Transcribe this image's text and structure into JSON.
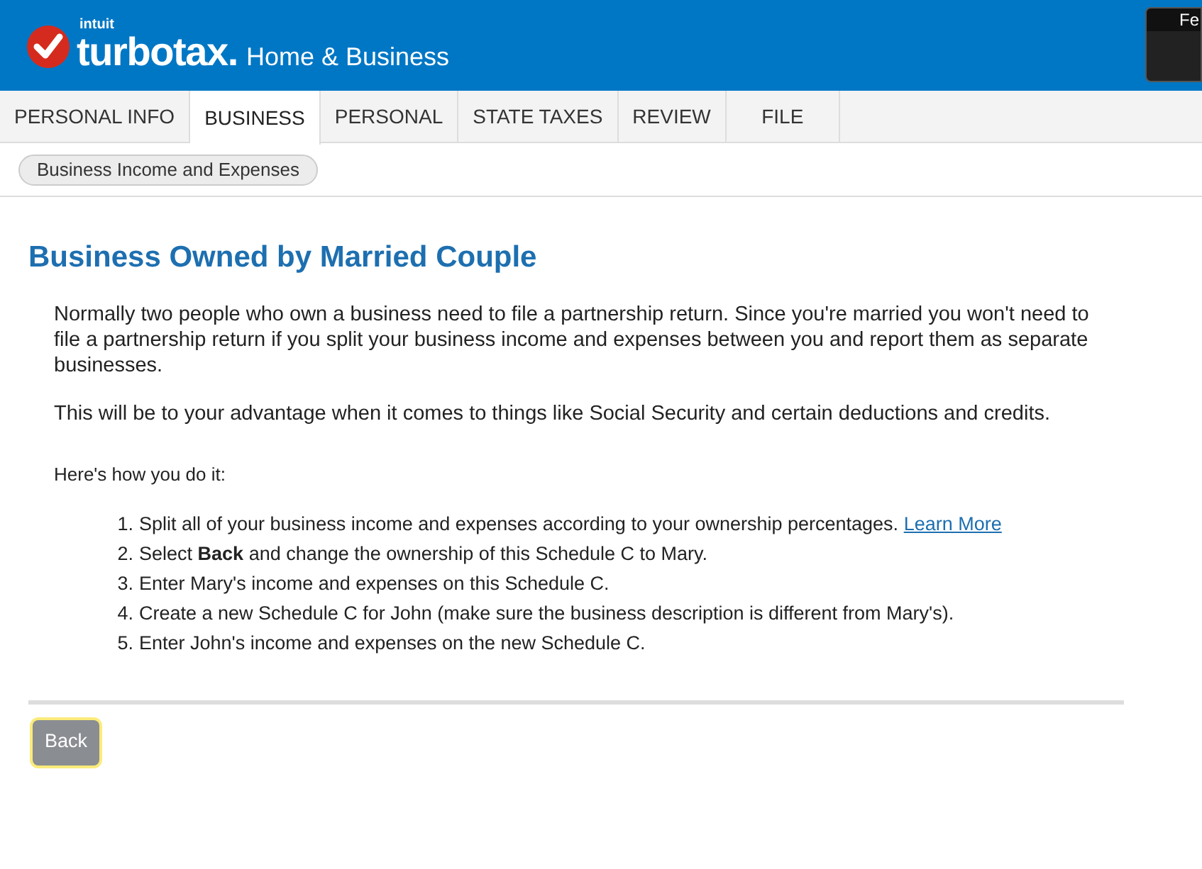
{
  "header": {
    "brand_small": "intuit",
    "brand": "turbotax",
    "brand_dot": ".",
    "product": "Home & Business",
    "corner_box": "Fe"
  },
  "tabs": [
    {
      "label": "PERSONAL INFO",
      "selected": false
    },
    {
      "label": "BUSINESS",
      "selected": true
    },
    {
      "label": "PERSONAL",
      "selected": false
    },
    {
      "label": "STATE TAXES",
      "selected": false
    },
    {
      "label": "REVIEW",
      "selected": false
    },
    {
      "label": "FILE",
      "selected": false
    }
  ],
  "breadcrumb": "Business Income and Expenses",
  "title": "Business Owned by Married Couple",
  "paragraphs": [
    "Normally two people who own a business need to file a partnership return. Since you're married you won't need to file a partnership return if you split your business income and expenses between you and report them as separate businesses.",
    "This will be to your advantage when it comes to things like Social Security and certain deductions and credits."
  ],
  "intro": "Here's how you do it:",
  "steps": [
    {
      "number": "1.",
      "text": "Split all of your business income and expenses according to your ownership percentages.",
      "link": "Learn More"
    },
    {
      "number": "2.",
      "text": "Select **Back** and change the ownership of this Schedule C to Mary."
    },
    {
      "number": "3.",
      "text": "Enter Mary's income and expenses on this Schedule C."
    },
    {
      "number": "4.",
      "text": "Create a new Schedule C for John (make sure the business description is different from Mary's)."
    },
    {
      "number": "5.",
      "text": "Enter John's income and expenses on the new Schedule C."
    }
  ],
  "back_button": "Back"
}
